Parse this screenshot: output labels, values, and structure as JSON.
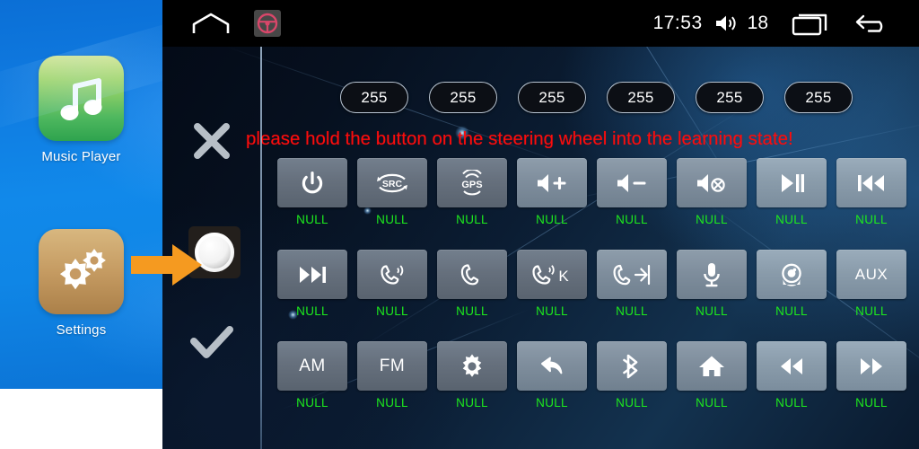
{
  "sidebar": {
    "apps": [
      {
        "label": "Music Player",
        "icon": "music-note-icon"
      },
      {
        "label": "Settings",
        "icon": "gears-icon"
      }
    ]
  },
  "statusbar": {
    "home_icon": "home-outline-icon",
    "steering_wheel_icon": "steering-wheel-icon",
    "time": "17:53",
    "volume_icon": "speaker-volume-icon",
    "volume_value": "18",
    "recents_icon": "recent-apps-icon",
    "back_icon": "back-arrow-icon"
  },
  "control_strip": {
    "cancel_icon": "close-x-icon",
    "knob_icon": "rotary-knob-icon",
    "confirm_icon": "checkmark-icon",
    "pointer_icon": "orange-arrow-icon"
  },
  "value_pills": [
    "255",
    "255",
    "255",
    "255",
    "255",
    "255"
  ],
  "warning_message": "please hold the button on the steering wheel into the learning state!",
  "colors": {
    "warning_red": "#fb0d0d",
    "null_green": "#1dea1d",
    "sidebar_blue": "#1189ea",
    "pointer_orange": "#f59a20",
    "panel_dark": "#0b1d33"
  },
  "button_grid": {
    "rows": [
      [
        {
          "icon": "power-icon",
          "text": "",
          "status": "NULL"
        },
        {
          "icon": "source-src-icon",
          "text": "SRC",
          "status": "NULL"
        },
        {
          "icon": "gps-icon",
          "text": "GPS",
          "status": "NULL"
        },
        {
          "icon": "volume-up-icon",
          "text": "",
          "status": "NULL"
        },
        {
          "icon": "volume-down-icon",
          "text": "",
          "status": "NULL"
        },
        {
          "icon": "volume-mute-icon",
          "text": "",
          "status": "NULL"
        },
        {
          "icon": "play-pause-icon",
          "text": "",
          "status": "NULL"
        },
        {
          "icon": "previous-track-icon",
          "text": "",
          "status": "NULL"
        }
      ],
      [
        {
          "icon": "next-track-icon",
          "text": "",
          "status": "NULL"
        },
        {
          "icon": "phone-answer-icon",
          "text": "",
          "status": "NULL"
        },
        {
          "icon": "phone-hangup-icon",
          "text": "",
          "status": "NULL"
        },
        {
          "icon": "phone-answer-key-icon",
          "text": "K",
          "status": "NULL"
        },
        {
          "icon": "phone-hangup-key-icon",
          "text": "",
          "status": "NULL"
        },
        {
          "icon": "microphone-icon",
          "text": "",
          "status": "NULL"
        },
        {
          "icon": "camera-icon",
          "text": "",
          "status": "NULL"
        },
        {
          "icon": "aux-icon",
          "text": "AUX",
          "status": "NULL"
        }
      ],
      [
        {
          "icon": "am-radio-icon",
          "text": "AM",
          "status": "NULL"
        },
        {
          "icon": "fm-radio-icon",
          "text": "FM",
          "status": "NULL"
        },
        {
          "icon": "brightness-icon",
          "text": "",
          "status": "NULL"
        },
        {
          "icon": "back-return-icon",
          "text": "",
          "status": "NULL"
        },
        {
          "icon": "bluetooth-icon",
          "text": "",
          "status": "NULL"
        },
        {
          "icon": "home-icon",
          "text": "",
          "status": "NULL"
        },
        {
          "icon": "rewind-icon",
          "text": "",
          "status": "NULL"
        },
        {
          "icon": "fast-forward-icon",
          "text": "",
          "status": "NULL"
        }
      ]
    ]
  }
}
